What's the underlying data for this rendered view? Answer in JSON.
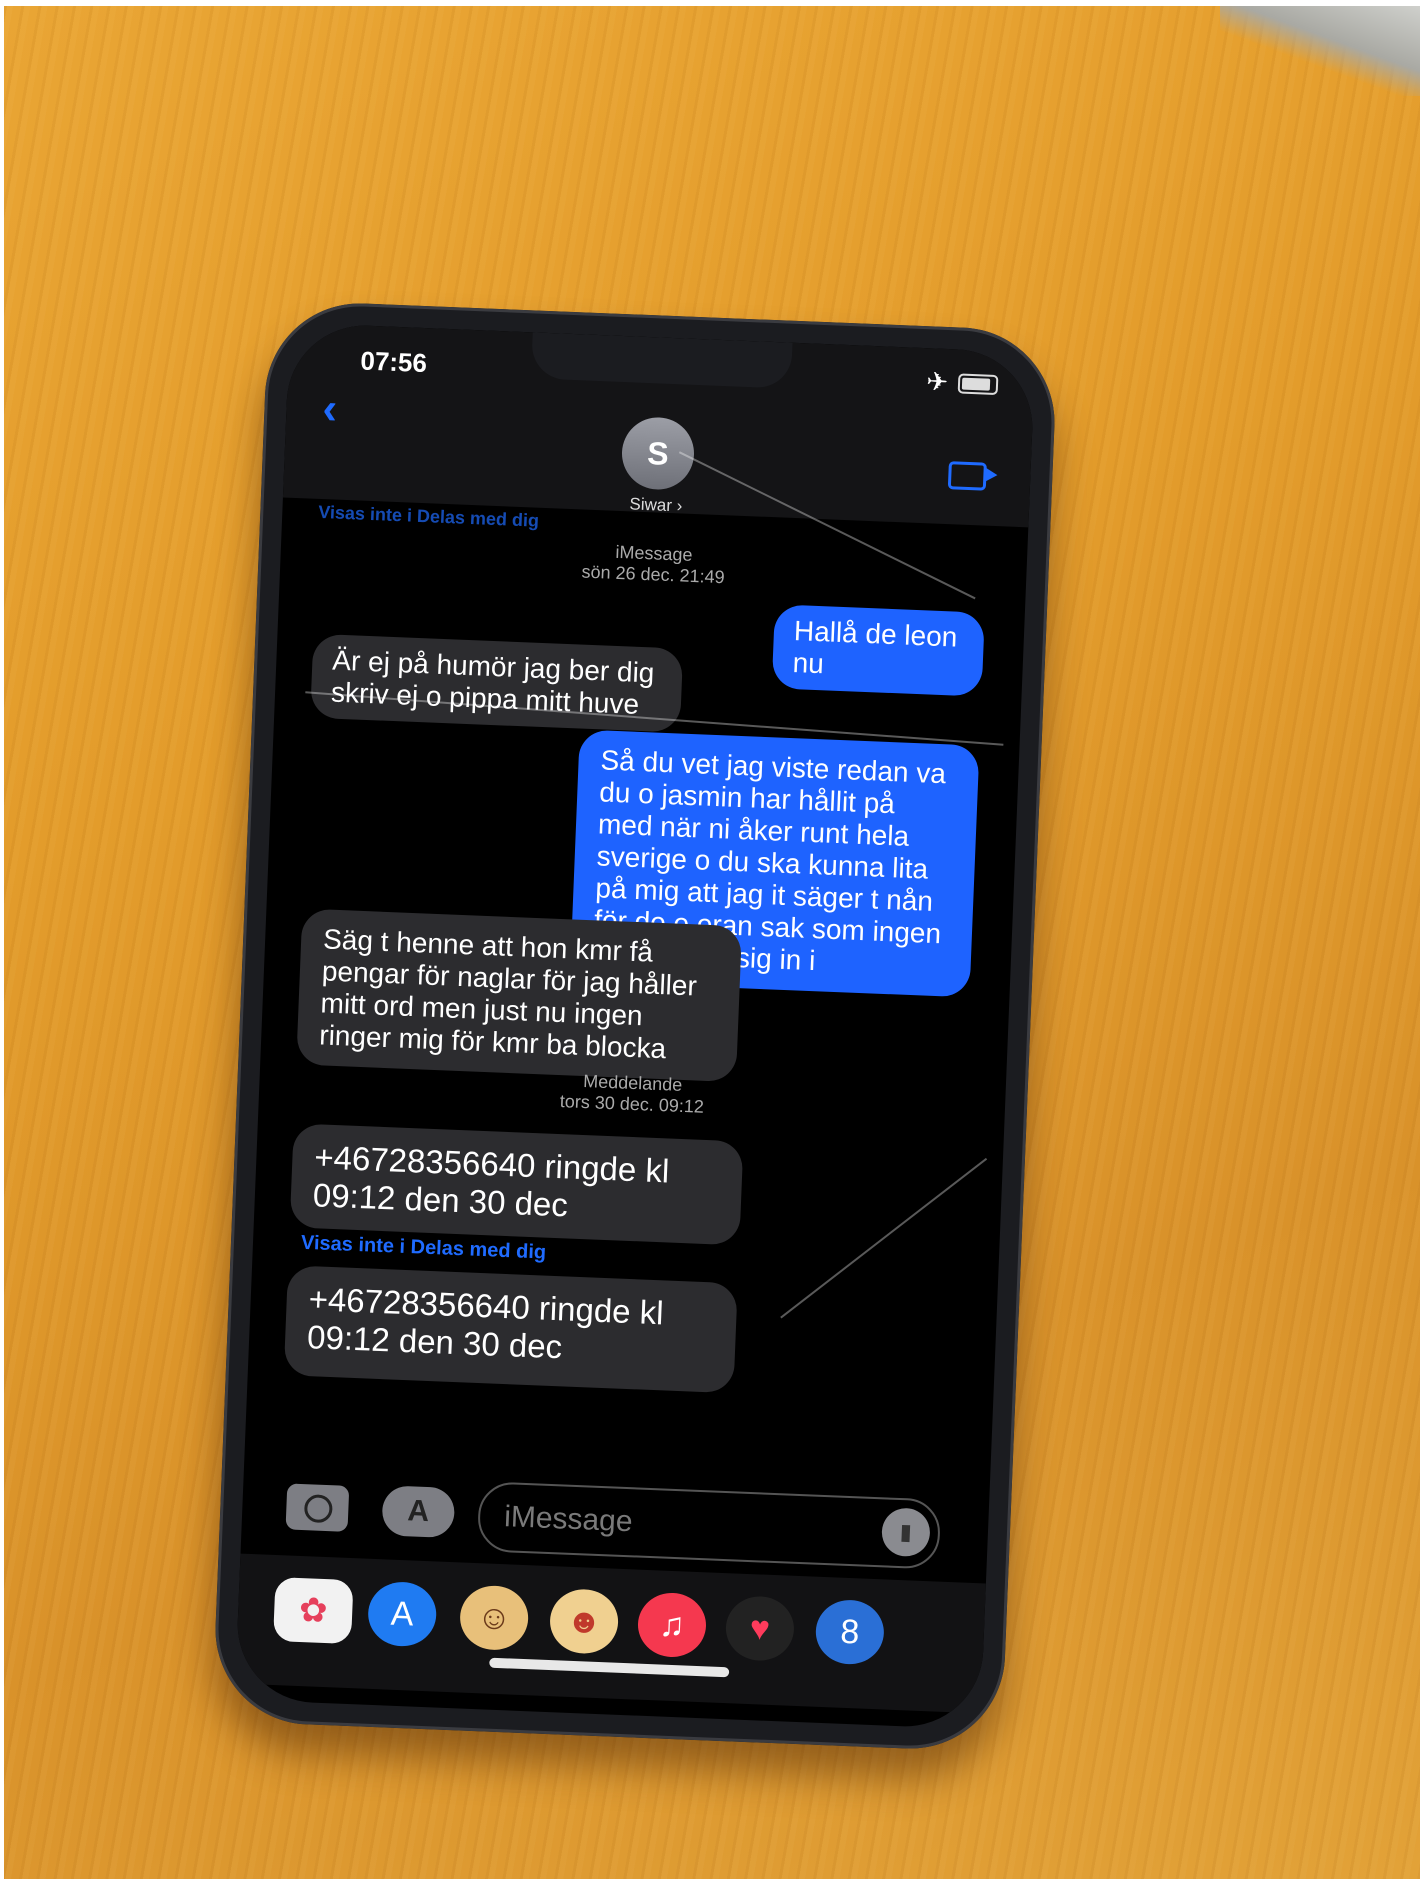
{
  "status_bar": {
    "time": "07:56"
  },
  "header": {
    "contact_initial": "S",
    "contact_name": "Siwar ›",
    "hidden_note": "Visas inte i Delas med dig"
  },
  "thread": {
    "stamp1_service": "iMessage",
    "stamp1_date": "sön 26 dec. 21:49",
    "msg1": "Hallå de leon nu",
    "msg2": "Är ej på humör jag ber dig skriv ej o pippa mitt huve",
    "msg3": "Så du vet jag viste redan va du o jasmin har hållit  på med när ni åker runt hela sverige o du ska kunna lita på mig att jag it säger t nån för de e eran sak som ingen ska blanda sig in i",
    "msg4": "Säg t henne att hon kmr få pengar för naglar för jag håller mitt ord men just nu ingen ringer mig för kmr ba blocka",
    "stamp2_service": "Meddelande",
    "stamp2_date": "tors 30 dec. 09:12",
    "msg5": "+46728356640  ringde kl 09:12 den 30 dec",
    "note": "Visas inte i Delas med dig",
    "msg6": "+46728356640  ringde kl 09:12 den 30 dec"
  },
  "composer": {
    "placeholder": "iMessage"
  },
  "colors": {
    "accent": "#1e63ff",
    "table": "#e3a030"
  },
  "icons": [
    "photos-icon",
    "app-store-icon",
    "memoji-icon",
    "memoji-stickers-icon",
    "music-icon",
    "digital-touch-icon",
    "pool-game-icon"
  ]
}
